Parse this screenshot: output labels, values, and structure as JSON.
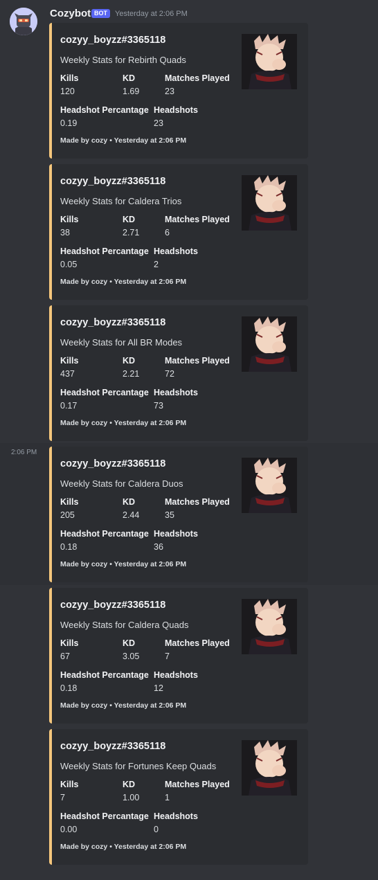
{
  "message": {
    "author": "Cozybot",
    "bot_badge": "BOT",
    "timestamp": "Yesterday at 2:06 PM",
    "hover_time": "2:06 PM"
  },
  "embeds": [
    {
      "title": "cozyy_boyzz#3365118",
      "description": "Weekly Stats for Rebirth Quads",
      "kills_label": "Kills",
      "kills": "120",
      "kd_label": "KD",
      "kd": "1.69",
      "matches_label": "Matches Played",
      "matches": "23",
      "hsp_label": "Headshot Percantage",
      "hsp": "0.19",
      "hs_label": "Headshots",
      "hs": "23",
      "footer": "Made by cozy • Yesterday at 2:06 PM"
    },
    {
      "title": "cozyy_boyzz#3365118",
      "description": "Weekly Stats for Caldera Trios",
      "kills_label": "Kills",
      "kills": "38",
      "kd_label": "KD",
      "kd": "2.71",
      "matches_label": "Matches Played",
      "matches": "6",
      "hsp_label": "Headshot Percantage",
      "hsp": "0.05",
      "hs_label": "Headshots",
      "hs": "2",
      "footer": "Made by cozy • Yesterday at 2:06 PM"
    },
    {
      "title": "cozyy_boyzz#3365118",
      "description": "Weekly Stats for All BR Modes",
      "kills_label": "Kills",
      "kills": "437",
      "kd_label": "KD",
      "kd": "2.21",
      "matches_label": "Matches Played",
      "matches": "72",
      "hsp_label": "Headshot Percantage",
      "hsp": "0.17",
      "hs_label": "Headshots",
      "hs": "73",
      "footer": "Made by cozy • Yesterday at 2:06 PM"
    },
    {
      "title": "cozyy_boyzz#3365118",
      "description": "Weekly Stats for Caldera Duos",
      "kills_label": "Kills",
      "kills": "205",
      "kd_label": "KD",
      "kd": "2.44",
      "matches_label": "Matches Played",
      "matches": "35",
      "hsp_label": "Headshot Percantage",
      "hsp": "0.18",
      "hs_label": "Headshots",
      "hs": "36",
      "footer": "Made by cozy • Yesterday at 2:06 PM"
    },
    {
      "title": "cozyy_boyzz#3365118",
      "description": "Weekly Stats for Caldera Quads",
      "kills_label": "Kills",
      "kills": "67",
      "kd_label": "KD",
      "kd": "3.05",
      "matches_label": "Matches Played",
      "matches": "7",
      "hsp_label": "Headshot Percantage",
      "hsp": "0.18",
      "hs_label": "Headshots",
      "hs": "12",
      "footer": "Made by cozy • Yesterday at 2:06 PM"
    },
    {
      "title": "cozyy_boyzz#3365118",
      "description": "Weekly Stats for Fortunes Keep Quads",
      "kills_label": "Kills",
      "kills": "7",
      "kd_label": "KD",
      "kd": "1.00",
      "matches_label": "Matches Played",
      "matches": "1",
      "hsp_label": "Headshot Percantage",
      "hsp": "0.00",
      "hs_label": "Headshots",
      "hs": "0",
      "footer": "Made by cozy • Yesterday at 2:06 PM"
    }
  ],
  "colors": {
    "embed_accent": "#f5c67c",
    "bot_badge": "#5865f2",
    "background": "#313338",
    "embed_bg": "#2b2d31"
  },
  "icons": {
    "avatar": "robot-avatar-icon",
    "thumbnail": "anime-character-thumbnail"
  }
}
